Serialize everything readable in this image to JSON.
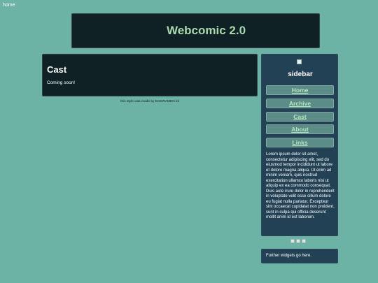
{
  "skip_link": "home",
  "header": {
    "title": "Webcomic 2.0"
  },
  "main": {
    "title": "Cast",
    "body": "Coming soon!"
  },
  "credit": "this style was made by EGGRAMEN lol",
  "sidebar": {
    "title": "sidebar",
    "nav": [
      {
        "label": "Home"
      },
      {
        "label": "Archive"
      },
      {
        "label": "Cast"
      },
      {
        "label": "About"
      },
      {
        "label": "Links"
      }
    ],
    "text": "Lorem ipsum dolor sit amet, consectetur adipiscing elit, sed do eiusmod tempor incididunt ut labore et dolore magna aliqua. Ut enim ad minim veniam, quis nostrud exercitation ullamco laboris nisi ut aliquip ex ea commodo consequat. Duis aute irure dolor in reprehenderit in voluptate velit esse cillum dolore eu fugiat nulla pariatur. Excepteur sint occaecat cupidatat non proident, sunt in culpa qui officia deserunt mollit anim id est laborum."
  },
  "widgets": {
    "text": "Further widgets go here."
  },
  "colors": {
    "background": "#6db3a5",
    "panel": "#0f2125",
    "sidebar": "#234154",
    "title_accent": "#a8d9ad",
    "nav_button": "#5c8c88"
  }
}
